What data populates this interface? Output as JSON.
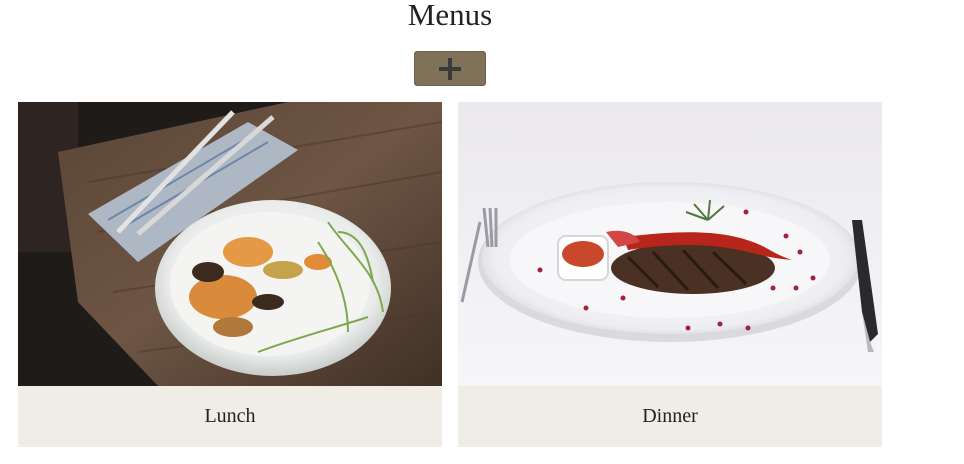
{
  "page": {
    "title": "Menus"
  },
  "toolbar": {
    "add_icon": "plus-icon",
    "accent_color": "#807259"
  },
  "menus": [
    {
      "label": "Lunch",
      "image": "roasted-carrots-bowl-photo"
    },
    {
      "label": "Dinner",
      "image": "steak-plate-photo"
    }
  ],
  "caption_background": "#f0ede6"
}
